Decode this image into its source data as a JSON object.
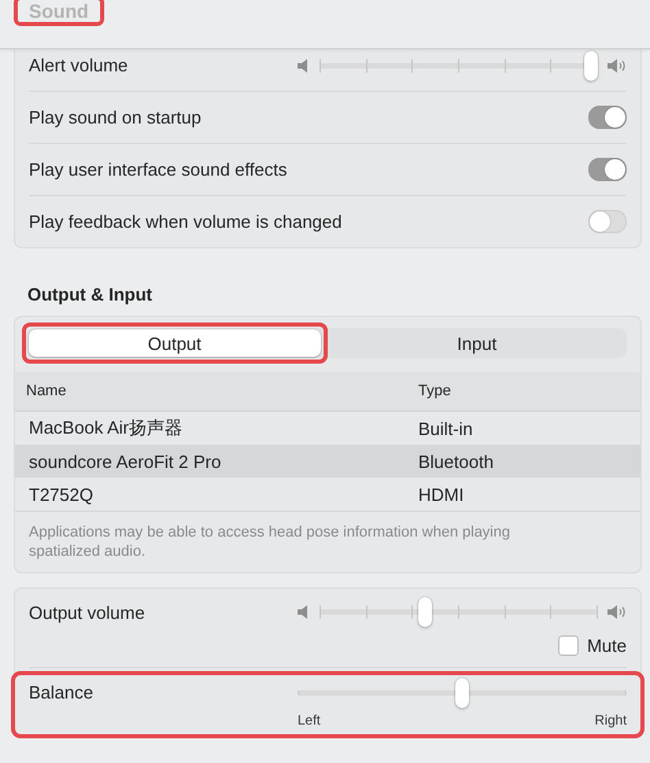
{
  "window": {
    "title": "Sound",
    "highlighted": true
  },
  "alerts": [
    {
      "kind": "slider",
      "label": "Alert volume",
      "level": 0.98
    },
    {
      "kind": "toggle",
      "label": "Play sound on startup",
      "on": true
    },
    {
      "kind": "toggle",
      "label": "Play user interface sound effects",
      "on": true
    },
    {
      "kind": "toggle",
      "label": "Play feedback when volume is changed",
      "on": false
    }
  ],
  "output_input": {
    "heading": "Output & Input",
    "tabs": [
      {
        "label": "Output",
        "selected": true,
        "highlighted": true
      },
      {
        "label": "Input",
        "selected": false,
        "highlighted": false
      }
    ],
    "columns": [
      "Name",
      "Type"
    ],
    "rows": [
      {
        "name": "MacBook Air扬声器",
        "type": "Built-in",
        "selected": false
      },
      {
        "name": "soundcore AeroFit 2 Pro",
        "type": "Bluetooth",
        "selected": true
      },
      {
        "name": "T2752Q",
        "type": "HDMI",
        "selected": false
      }
    ],
    "note": "Applications may be able to access head pose information when playing spatialized audio."
  },
  "output": {
    "volume": {
      "label": "Output volume",
      "level": 0.38
    },
    "mute": {
      "label": "Mute",
      "checked": false
    },
    "balance": {
      "label": "Balance",
      "level": 0.5,
      "left_label": "Left",
      "right_label": "Right",
      "highlighted": true
    }
  }
}
